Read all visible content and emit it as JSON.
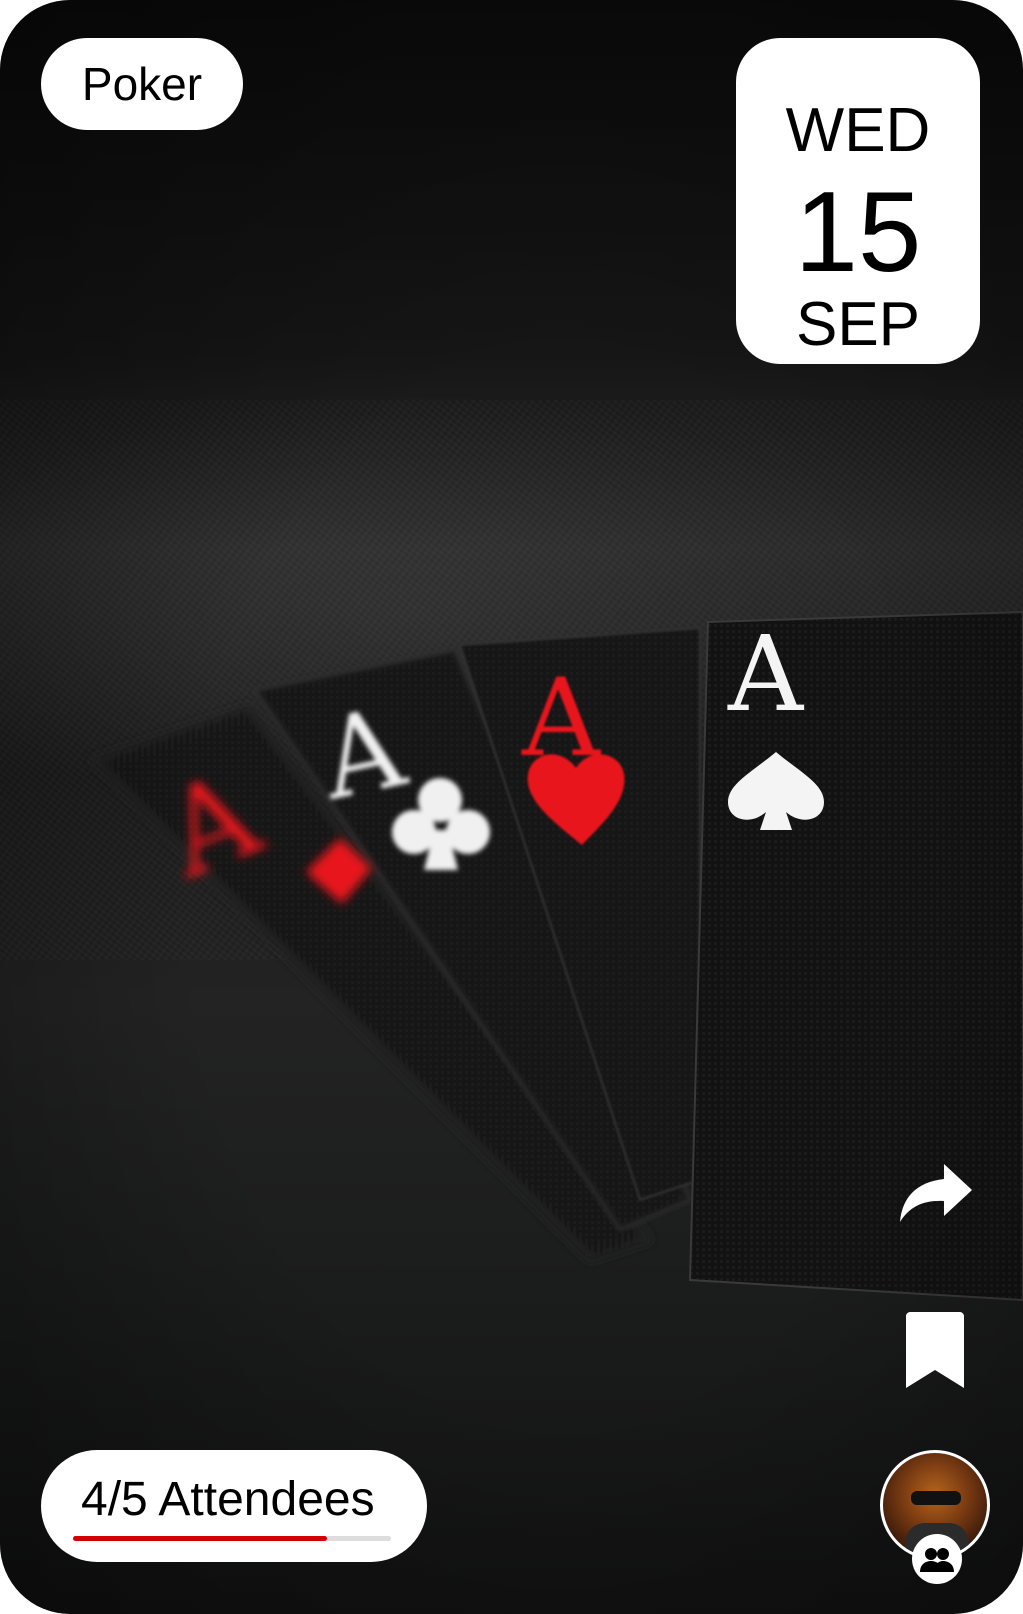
{
  "event": {
    "category": "Poker",
    "date": {
      "weekday": "WED",
      "day": "15",
      "month": "SEP"
    },
    "attendees": {
      "label": "4/5 Attendees",
      "current": 4,
      "capacity": 5
    }
  },
  "cards": [
    {
      "rank": "A",
      "suit": "diamond",
      "color": "#e8121e"
    },
    {
      "rank": "A",
      "suit": "club",
      "color": "#f2f2f2"
    },
    {
      "rank": "A",
      "suit": "heart",
      "color": "#e8121e"
    },
    {
      "rank": "A",
      "suit": "spade",
      "color": "#f2f2f2"
    }
  ],
  "actions": {
    "share_icon": "share-icon",
    "bookmark_icon": "bookmark-icon",
    "avatar": "host-avatar",
    "group_icon": "group-icon"
  },
  "colors": {
    "accent": "#d40000",
    "progress_track": "#dddddd"
  }
}
